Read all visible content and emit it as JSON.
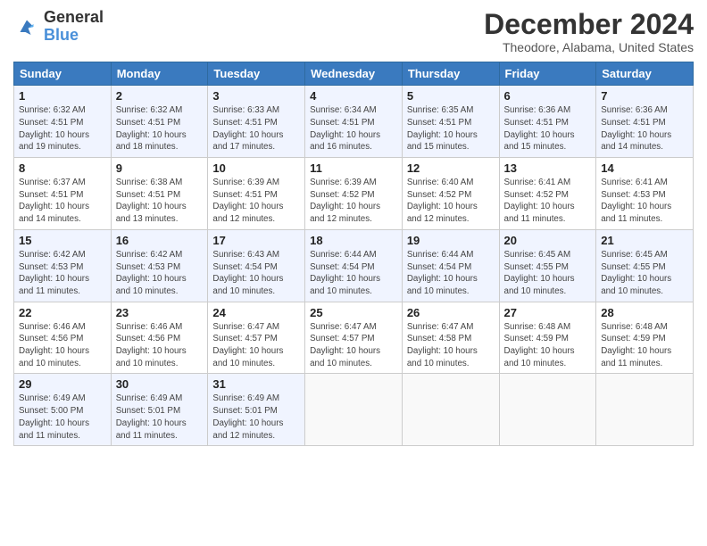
{
  "header": {
    "logo_line1": "General",
    "logo_line2": "Blue",
    "month": "December 2024",
    "location": "Theodore, Alabama, United States"
  },
  "days_of_week": [
    "Sunday",
    "Monday",
    "Tuesday",
    "Wednesday",
    "Thursday",
    "Friday",
    "Saturday"
  ],
  "weeks": [
    [
      {
        "day": "1",
        "info": "Sunrise: 6:32 AM\nSunset: 4:51 PM\nDaylight: 10 hours\nand 19 minutes."
      },
      {
        "day": "2",
        "info": "Sunrise: 6:32 AM\nSunset: 4:51 PM\nDaylight: 10 hours\nand 18 minutes."
      },
      {
        "day": "3",
        "info": "Sunrise: 6:33 AM\nSunset: 4:51 PM\nDaylight: 10 hours\nand 17 minutes."
      },
      {
        "day": "4",
        "info": "Sunrise: 6:34 AM\nSunset: 4:51 PM\nDaylight: 10 hours\nand 16 minutes."
      },
      {
        "day": "5",
        "info": "Sunrise: 6:35 AM\nSunset: 4:51 PM\nDaylight: 10 hours\nand 15 minutes."
      },
      {
        "day": "6",
        "info": "Sunrise: 6:36 AM\nSunset: 4:51 PM\nDaylight: 10 hours\nand 15 minutes."
      },
      {
        "day": "7",
        "info": "Sunrise: 6:36 AM\nSunset: 4:51 PM\nDaylight: 10 hours\nand 14 minutes."
      }
    ],
    [
      {
        "day": "8",
        "info": "Sunrise: 6:37 AM\nSunset: 4:51 PM\nDaylight: 10 hours\nand 14 minutes."
      },
      {
        "day": "9",
        "info": "Sunrise: 6:38 AM\nSunset: 4:51 PM\nDaylight: 10 hours\nand 13 minutes."
      },
      {
        "day": "10",
        "info": "Sunrise: 6:39 AM\nSunset: 4:51 PM\nDaylight: 10 hours\nand 12 minutes."
      },
      {
        "day": "11",
        "info": "Sunrise: 6:39 AM\nSunset: 4:52 PM\nDaylight: 10 hours\nand 12 minutes."
      },
      {
        "day": "12",
        "info": "Sunrise: 6:40 AM\nSunset: 4:52 PM\nDaylight: 10 hours\nand 12 minutes."
      },
      {
        "day": "13",
        "info": "Sunrise: 6:41 AM\nSunset: 4:52 PM\nDaylight: 10 hours\nand 11 minutes."
      },
      {
        "day": "14",
        "info": "Sunrise: 6:41 AM\nSunset: 4:53 PM\nDaylight: 10 hours\nand 11 minutes."
      }
    ],
    [
      {
        "day": "15",
        "info": "Sunrise: 6:42 AM\nSunset: 4:53 PM\nDaylight: 10 hours\nand 11 minutes."
      },
      {
        "day": "16",
        "info": "Sunrise: 6:42 AM\nSunset: 4:53 PM\nDaylight: 10 hours\nand 10 minutes."
      },
      {
        "day": "17",
        "info": "Sunrise: 6:43 AM\nSunset: 4:54 PM\nDaylight: 10 hours\nand 10 minutes."
      },
      {
        "day": "18",
        "info": "Sunrise: 6:44 AM\nSunset: 4:54 PM\nDaylight: 10 hours\nand 10 minutes."
      },
      {
        "day": "19",
        "info": "Sunrise: 6:44 AM\nSunset: 4:54 PM\nDaylight: 10 hours\nand 10 minutes."
      },
      {
        "day": "20",
        "info": "Sunrise: 6:45 AM\nSunset: 4:55 PM\nDaylight: 10 hours\nand 10 minutes."
      },
      {
        "day": "21",
        "info": "Sunrise: 6:45 AM\nSunset: 4:55 PM\nDaylight: 10 hours\nand 10 minutes."
      }
    ],
    [
      {
        "day": "22",
        "info": "Sunrise: 6:46 AM\nSunset: 4:56 PM\nDaylight: 10 hours\nand 10 minutes."
      },
      {
        "day": "23",
        "info": "Sunrise: 6:46 AM\nSunset: 4:56 PM\nDaylight: 10 hours\nand 10 minutes."
      },
      {
        "day": "24",
        "info": "Sunrise: 6:47 AM\nSunset: 4:57 PM\nDaylight: 10 hours\nand 10 minutes."
      },
      {
        "day": "25",
        "info": "Sunrise: 6:47 AM\nSunset: 4:57 PM\nDaylight: 10 hours\nand 10 minutes."
      },
      {
        "day": "26",
        "info": "Sunrise: 6:47 AM\nSunset: 4:58 PM\nDaylight: 10 hours\nand 10 minutes."
      },
      {
        "day": "27",
        "info": "Sunrise: 6:48 AM\nSunset: 4:59 PM\nDaylight: 10 hours\nand 10 minutes."
      },
      {
        "day": "28",
        "info": "Sunrise: 6:48 AM\nSunset: 4:59 PM\nDaylight: 10 hours\nand 11 minutes."
      }
    ],
    [
      {
        "day": "29",
        "info": "Sunrise: 6:49 AM\nSunset: 5:00 PM\nDaylight: 10 hours\nand 11 minutes."
      },
      {
        "day": "30",
        "info": "Sunrise: 6:49 AM\nSunset: 5:01 PM\nDaylight: 10 hours\nand 11 minutes."
      },
      {
        "day": "31",
        "info": "Sunrise: 6:49 AM\nSunset: 5:01 PM\nDaylight: 10 hours\nand 12 minutes."
      },
      {
        "day": "",
        "info": ""
      },
      {
        "day": "",
        "info": ""
      },
      {
        "day": "",
        "info": ""
      },
      {
        "day": "",
        "info": ""
      }
    ]
  ]
}
